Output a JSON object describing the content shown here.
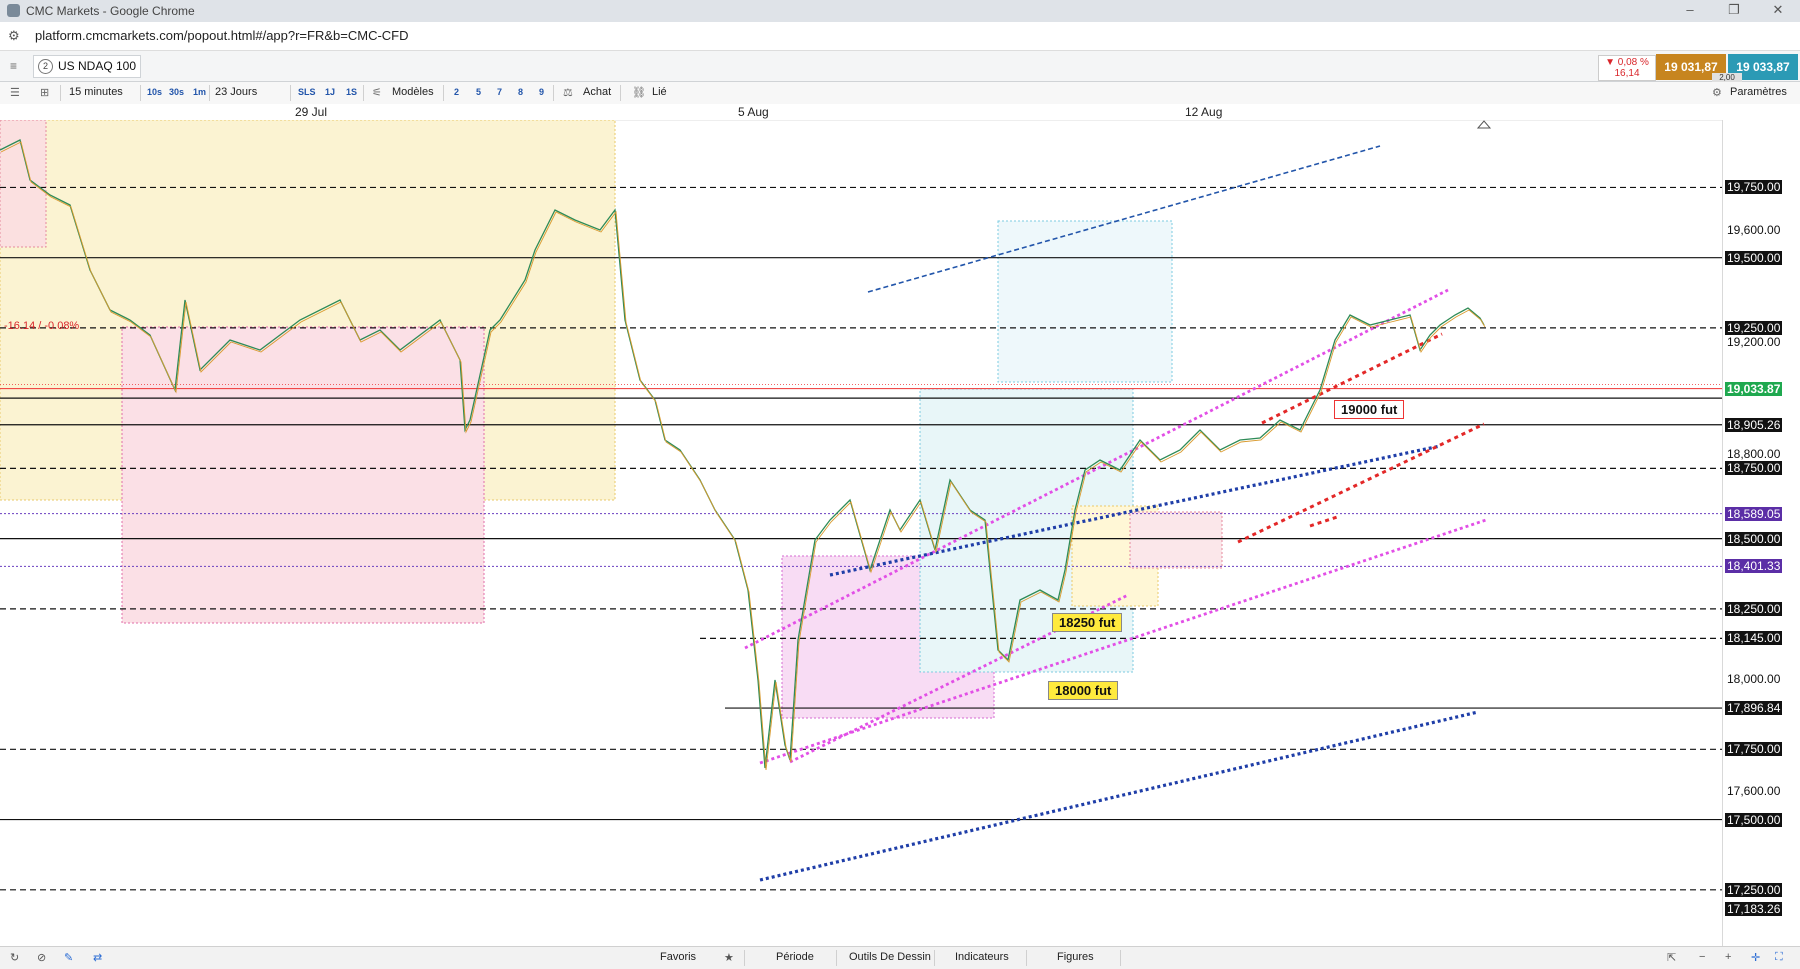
{
  "window": {
    "title": "CMC Markets - Google Chrome"
  },
  "browser": {
    "url": "platform.cmcmarkets.com/popout.html#/app?r=FR&b=CMC-CFD"
  },
  "instrument": {
    "number": "2",
    "name": "US NDAQ 100",
    "change_pct": "▼ 0,08 %",
    "change_pts": "16,14",
    "sell_price": "19 031,87",
    "buy_price": "19 033,87",
    "spread": "2,00",
    "colors": {
      "sell": "#c7851f",
      "buy": "#2b9ab5",
      "down": "#d9262b"
    }
  },
  "toolbar": {
    "interval": "15 minutes",
    "tick_buttons": [
      "10s",
      "30s",
      "1m"
    ],
    "range": "23 Jours",
    "view_buttons": [
      "SLS",
      "1J",
      "1S"
    ],
    "models_label": "Modèles",
    "number_buttons": [
      "2",
      "5",
      "7",
      "8",
      "9"
    ],
    "buy_label": "Achat",
    "linked_label": "Lié",
    "settings_label": "Paramètres"
  },
  "chart_data": {
    "type": "line",
    "x_labels": [
      "29 Jul",
      "5 Aug",
      "12 Aug"
    ],
    "y_ticks": [
      "19,750.00",
      "19,600.00",
      "19,500.00",
      "19,250.00",
      "19,200.00",
      "19,033.87",
      "18,905.26",
      "18,800.00",
      "18,750.00",
      "18,589.05",
      "18,500.00",
      "18,401.33",
      "18,250.00",
      "18,145.00",
      "18,000.00",
      "17,896.84",
      "17,750.00",
      "17,600.00",
      "17,500.00",
      "17,250.00",
      "17,183.26"
    ],
    "y_range": [
      17050,
      19990
    ],
    "current_price": 19033.87,
    "change_label": "-16.14 / -0.08%",
    "horizontal_levels": [
      {
        "price": 19750,
        "style": "dashed",
        "label": "19,750.00"
      },
      {
        "price": 19500,
        "style": "solid",
        "label": "19,500.00"
      },
      {
        "price": 19250,
        "style": "dashed",
        "label": "19,250.00"
      },
      {
        "price": 19000,
        "style": "solid",
        "label": ""
      },
      {
        "price": 18905.26,
        "style": "solid",
        "label": "18,905.26"
      },
      {
        "price": 18750,
        "style": "dashed",
        "label": "18,750.00"
      },
      {
        "price": 18589.05,
        "style": "dotted-purple",
        "label": "18,589.05"
      },
      {
        "price": 18500,
        "style": "solid",
        "label": "18,500.00"
      },
      {
        "price": 18401.33,
        "style": "dotted-purple",
        "label": "18,401.33"
      },
      {
        "price": 18250,
        "style": "dashed",
        "label": "18,250.00"
      },
      {
        "price": 18145,
        "style": "dashed",
        "label": "18,145.00"
      },
      {
        "price": 17896.84,
        "style": "solid",
        "label": "17,896.84"
      },
      {
        "price": 17750,
        "style": "dashed",
        "label": "17,750.00"
      },
      {
        "price": 17500,
        "style": "solid",
        "label": "17,500.00"
      },
      {
        "price": 17250,
        "style": "dashed",
        "label": "17,250.00"
      }
    ],
    "annotations": [
      "19000 fut",
      "18250 fut",
      "18000 fut"
    ],
    "grid": false
  },
  "bottom": {
    "favorites_label": "Favoris",
    "period_label": "Période",
    "drawing_tools_label": "Outils De Dessin",
    "indicators_label": "Indicateurs",
    "figures_label": "Figures"
  }
}
